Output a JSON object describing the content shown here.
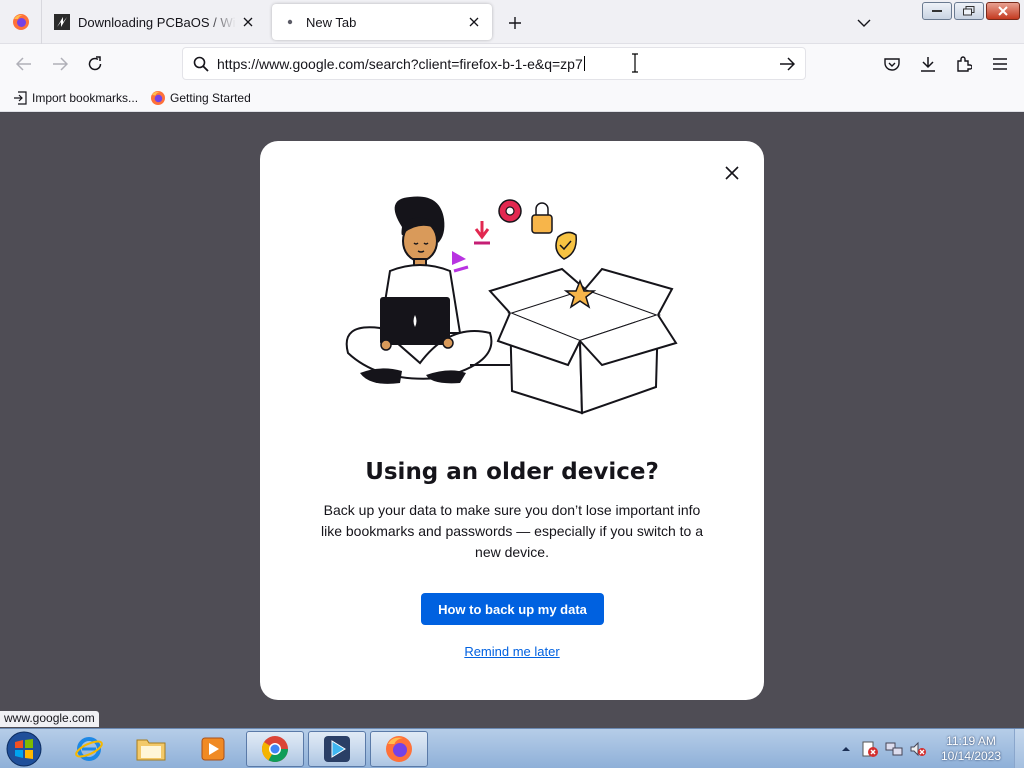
{
  "browser": {
    "tabs": [
      {
        "title": "Downloading PCBaOS / Windo",
        "icon": "pcbaos-favicon",
        "active": false
      },
      {
        "title": "New Tab",
        "icon": "dot-icon",
        "active": true
      }
    ],
    "url": "https://www.google.com/search?client=firefox-b-1-e&q=zp7",
    "bookmarks": [
      {
        "label": "Import bookmarks...",
        "icon": "import-icon"
      },
      {
        "label": "Getting Started",
        "icon": "firefox-icon"
      }
    ]
  },
  "modal": {
    "title": "Using an older device?",
    "body": "Back up your data to make sure you don’t lose important info like bookmarks and passwords — especially if you switch to a new device.",
    "primary_button": "How to back up my data",
    "secondary_link": "Remind me later"
  },
  "status_bar": {
    "url": "www.google.com"
  },
  "taskbar": {
    "apps": [
      "internet-explorer",
      "file-explorer",
      "media-player",
      "chrome",
      "media-center",
      "firefox"
    ],
    "clock": {
      "time": "11:19 AM",
      "date": "10/14/2023"
    }
  },
  "colors": {
    "accent": "#0061e0",
    "backdrop": "#4f4d55",
    "tab_strip": "#f0f0f4"
  }
}
